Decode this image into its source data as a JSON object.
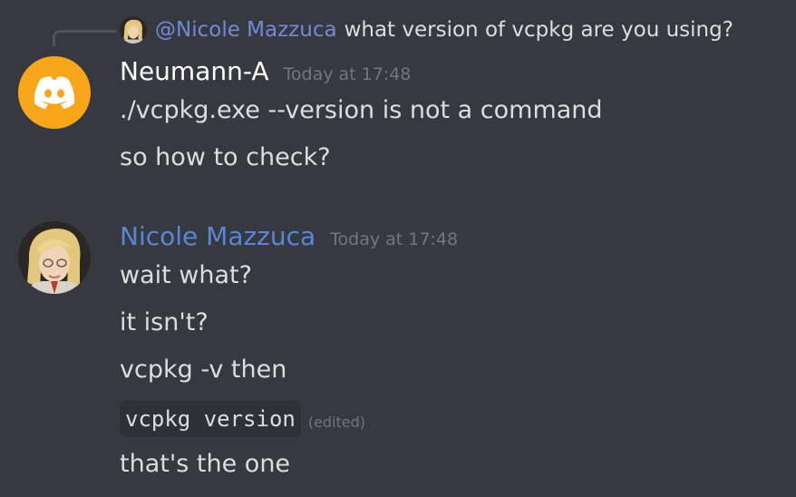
{
  "reply": {
    "mention": "@Nicole Mazzuca",
    "text": "what version of vcpkg are you using?"
  },
  "messages": [
    {
      "author": "Neumann-A",
      "timestamp": "Today at 17:48",
      "avatar_icon": "discord-logo-icon",
      "avatar_color": "#faa61a",
      "lines": [
        "./vcpkg.exe --version is not a command",
        "so how to check?"
      ]
    },
    {
      "author": "Nicole Mazzuca",
      "timestamp": "Today at 17:48",
      "author_color": "#5b86d6",
      "lines": [
        "wait what?",
        "it isn't?",
        "vcpkg -v then"
      ],
      "code": "vcpkg version",
      "edited": "(edited)",
      "last_line": "that's the one"
    }
  ],
  "colors": {
    "background": "#36393f",
    "text": "#dcddde",
    "muted": "#72767d",
    "mention": "#7289da"
  }
}
